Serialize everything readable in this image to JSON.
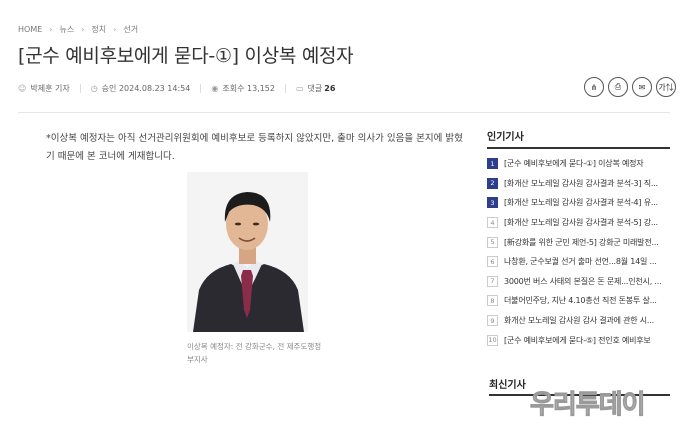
{
  "breadcrumb": [
    "HOME",
    "뉴스",
    "정치",
    "선거"
  ],
  "article": {
    "title": "[군수 예비후보에게 묻다-①] 이상복 예정자",
    "reporter": "박제훈 기자",
    "approved_label": "승인",
    "approved_time": "2024.08.23 14:54",
    "views_label": "조회수",
    "views": "13,152",
    "comments_label": "댓글",
    "comments": "26",
    "intro": "*이상복 예정자는 아직 선거관리위원회에 예비후보로 등록하지 않았지만, 출마 의사가 있음을 본지에 밝혔기 때문에 본 코너에 게재합니다.",
    "photo_caption": "이상복 예정자: 전 강화군수, 전 제주도행정부지사"
  },
  "tools": [
    {
      "name": "share-icon",
      "glyph": "⋔"
    },
    {
      "name": "print-icon",
      "glyph": "⎙"
    },
    {
      "name": "mail-icon",
      "glyph": "✉"
    },
    {
      "name": "font-size-icon",
      "glyph": "가⇅"
    }
  ],
  "popular": {
    "heading": "인기기사",
    "items": [
      {
        "rank": "1",
        "title": "[군수 예비후보에게 묻다-①] 이상복 예정자"
      },
      {
        "rank": "2",
        "title": "[화개산 모노레일 감사원 감사결과 분석-3] 직..."
      },
      {
        "rank": "3",
        "title": "[화개산 모노레일 감사원 감사결과 분석-4] 유..."
      },
      {
        "rank": "4",
        "title": "[화개산 모노레일 감사원 감사결과 분석-5] 강..."
      },
      {
        "rank": "5",
        "title": "[新강화를 위한 군민 제언-5] 강화군 미래발전..."
      },
      {
        "rank": "6",
        "title": "나창환, 군수보궐 선거 출마 선언...8월 14일 ..."
      },
      {
        "rank": "7",
        "title": "3000번 버스 사태의 본질은 돈 문제...인천시, ..."
      },
      {
        "rank": "8",
        "title": "더불어민주당, 지난 4.10총선 직전 돈봉투 살..."
      },
      {
        "rank": "9",
        "title": "화개산 모노레일 감사원 감사 결과에 관한 시..."
      },
      {
        "rank": "10",
        "title": "[군수 예비후보에게 묻다-⑤] 전인호 예비후보"
      }
    ]
  },
  "recent_heading": "최신기사",
  "watermark": "우리투데이"
}
